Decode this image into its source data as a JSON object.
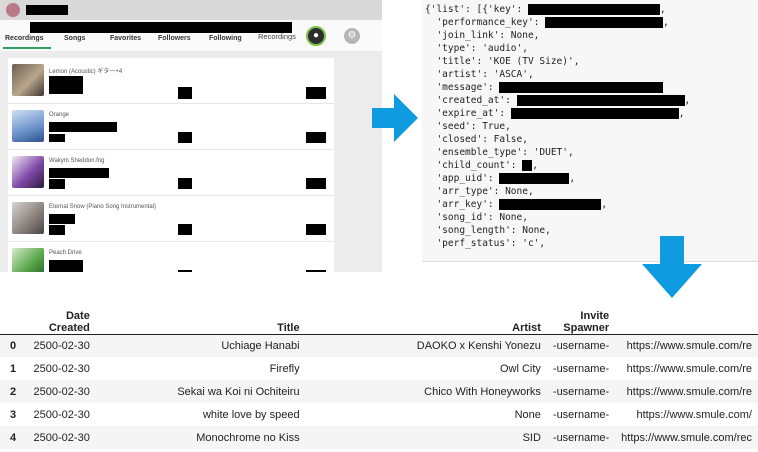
{
  "app": {
    "tabs": [
      "Recordings",
      "Songs",
      "Favorites",
      "Followers",
      "Following"
    ],
    "toolbar_right_label": "Recordings",
    "mic_icon": "microphone-icon",
    "settings_icon": "settings-icon",
    "recordings": [
      {
        "title": "Lemon (Acoustic) ギター+4"
      },
      {
        "title": "Orange"
      },
      {
        "title": "Wakym Sheddon.fng"
      },
      {
        "title": "Eternal Snow (Piano Song Instrumental)"
      },
      {
        "title": "Peach Drive"
      }
    ]
  },
  "code": {
    "lines": [
      {
        "pre": "{'list': [{'key': ",
        "redact": true,
        "post": ","
      },
      {
        "pre": "  'performance_key': ",
        "redact": true,
        "post": ","
      },
      {
        "pre": "  'join_link': None,",
        "redact": false,
        "post": ""
      },
      {
        "pre": "  'type': 'audio',",
        "redact": false,
        "post": ""
      },
      {
        "pre": "  'title': 'KOE (TV Size)',",
        "redact": false,
        "post": ""
      },
      {
        "pre": "  'artist': 'ASCA',",
        "redact": false,
        "post": ""
      },
      {
        "pre": "  'message': ",
        "redact": true,
        "post": ""
      },
      {
        "pre": "  'created_at': ",
        "redact": true,
        "post": ","
      },
      {
        "pre": "  'expire_at': ",
        "redact": true,
        "post": ","
      },
      {
        "pre": "  'seed': True,",
        "redact": false,
        "post": ""
      },
      {
        "pre": "  'closed': False,",
        "redact": false,
        "post": ""
      },
      {
        "pre": "  'ensemble_type': 'DUET',",
        "redact": false,
        "post": ""
      },
      {
        "pre": "  'child_count': ",
        "redact": true,
        "post": ","
      },
      {
        "pre": "  'app_uid': ",
        "redact": true,
        "post": ","
      },
      {
        "pre": "  'arr_type': None,",
        "redact": false,
        "post": ""
      },
      {
        "pre": "  'arr_key': ",
        "redact": true,
        "post": ","
      },
      {
        "pre": "  'song_id': None,",
        "redact": false,
        "post": ""
      },
      {
        "pre": "  'song_length': None,",
        "redact": false,
        "post": ""
      },
      {
        "pre": "  'perf_status': 'c',",
        "redact": false,
        "post": ""
      }
    ]
  },
  "arrows": {
    "right_icon": "arrow-right-icon",
    "down_icon": "arrow-down-icon",
    "color": "#0f9be0"
  },
  "dataframe": {
    "columns": [
      "",
      "Date Created",
      "Title",
      "Artist",
      "Invite Spawner",
      ""
    ],
    "rows": [
      {
        "index": "0",
        "date": "2500-02-30",
        "title": "Uchiage Hanabi",
        "artist": "DAOKO x Kenshi Yonezu",
        "spawner": "-username-",
        "url": "https://www.smule.com/re"
      },
      {
        "index": "1",
        "date": "2500-02-30",
        "title": "Firefly",
        "artist": "Owl City",
        "spawner": "-username-",
        "url": "https://www.smule.com/re"
      },
      {
        "index": "2",
        "date": "2500-02-30",
        "title": "Sekai wa Koi ni Ochiteiru",
        "artist": "Chico With Honeyworks",
        "spawner": "-username-",
        "url": "https://www.smule.com/re"
      },
      {
        "index": "3",
        "date": "2500-02-30",
        "title": "white love by speed",
        "artist": "None",
        "spawner": "-username-",
        "url": "https://www.smule.com/"
      },
      {
        "index": "4",
        "date": "2500-02-30",
        "title": "Monochrome no Kiss",
        "artist": "SID",
        "spawner": "-username-",
        "url": "https://www.smule.com/rec"
      }
    ]
  }
}
